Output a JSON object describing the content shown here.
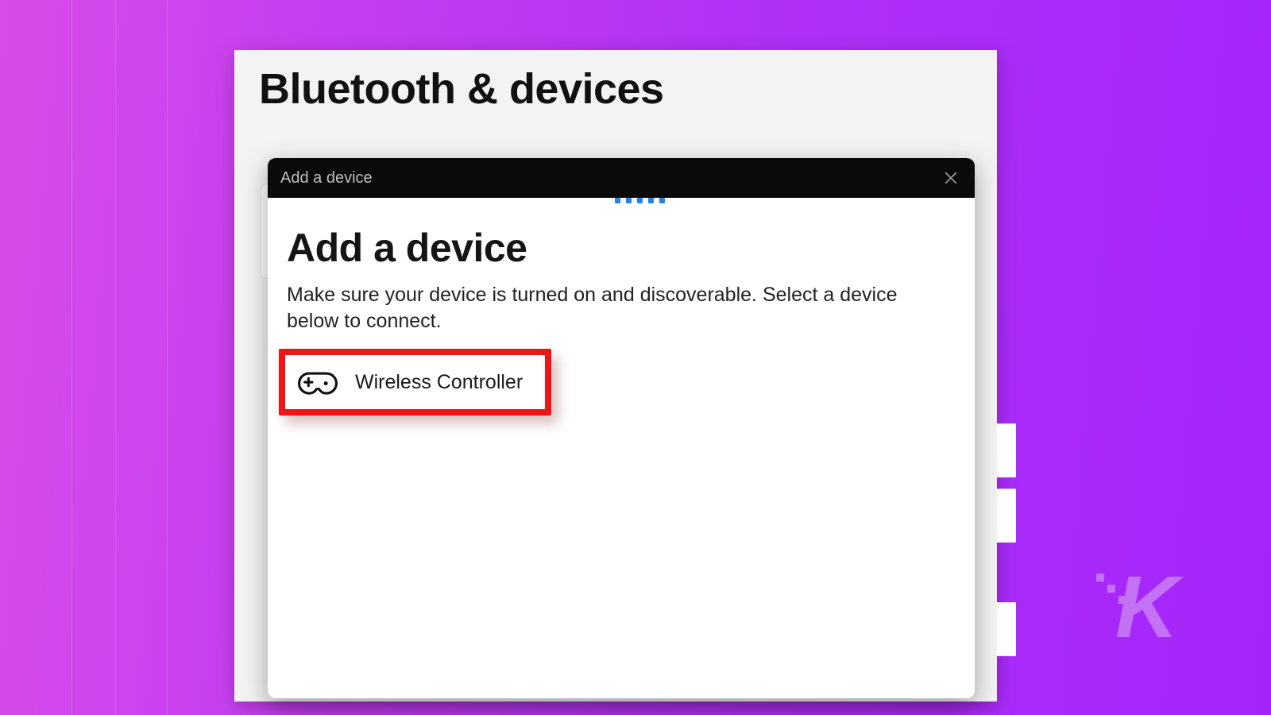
{
  "page": {
    "title": "Bluetooth & devices"
  },
  "dialog": {
    "window_title": "Add a device",
    "heading": "Add a device",
    "description": "Make sure your device is turned on and discoverable. Select a device below to connect.",
    "devices": [
      {
        "icon": "gamepad-icon",
        "name": "Wireless Controller"
      }
    ]
  },
  "colors": {
    "accent": "#1d86e6",
    "highlight_box": "#f01414"
  }
}
